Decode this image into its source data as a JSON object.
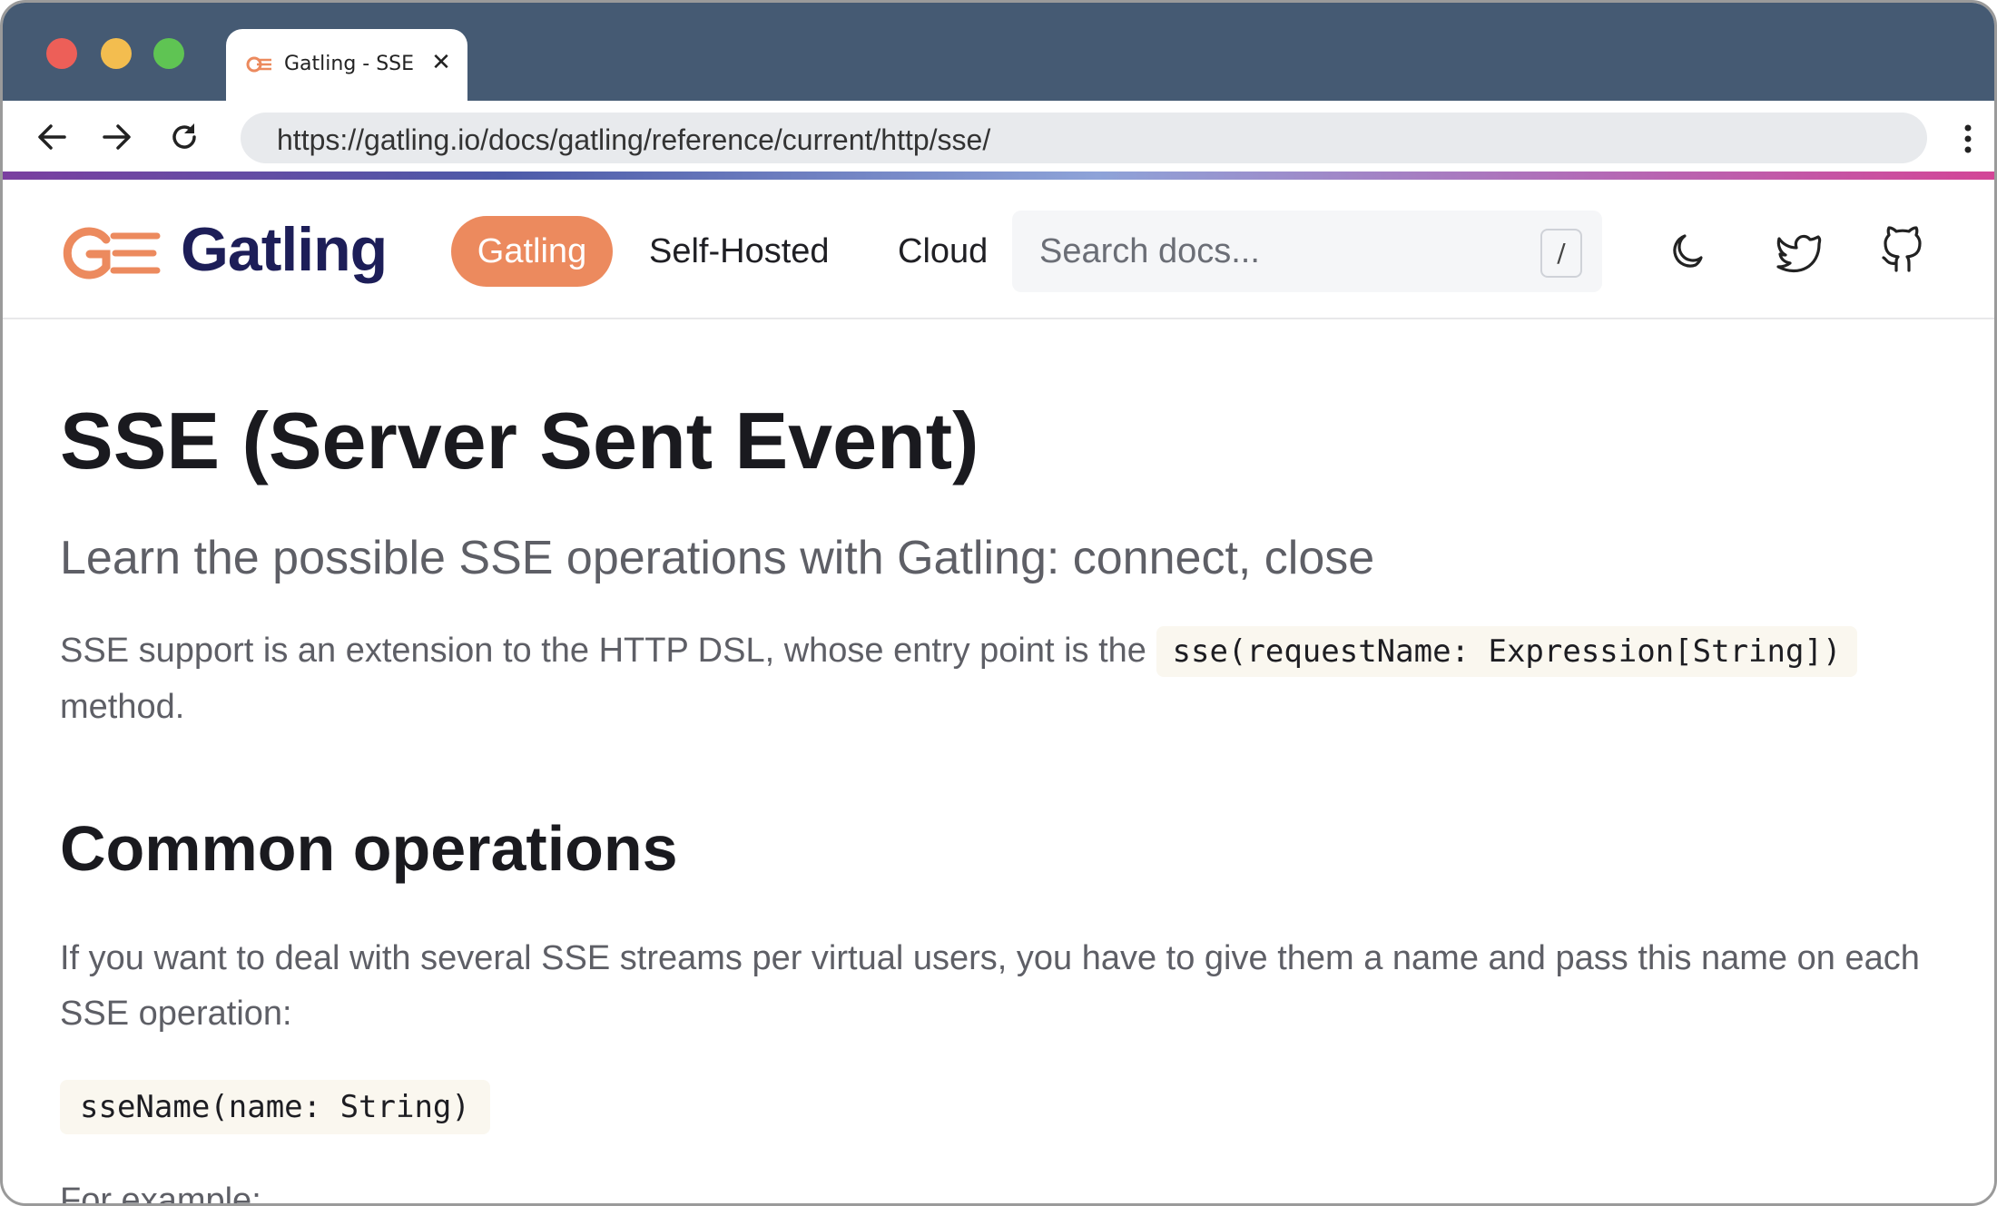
{
  "browser": {
    "tab_title": "Gatling - SSE",
    "tab_close": "✕",
    "url": "https://gatling.io/docs/gatling/reference/current/http/sse/"
  },
  "header": {
    "logo_text": "Gatling",
    "nav": {
      "active_label": "Gatling",
      "self_hosted_label": "Self-Hosted",
      "cloud_label": "Cloud"
    },
    "search": {
      "placeholder": "Search docs...",
      "shortcut": "/"
    },
    "icons": [
      "moon-icon",
      "twitter-icon",
      "github-icon"
    ]
  },
  "page": {
    "title": "SSE (Server Sent Event)",
    "lead": "Learn the possible SSE operations with Gatling: connect, close",
    "intro_text": "SSE support is an extension to the HTTP DSL, whose entry point is the",
    "intro_code": "sse(requestName: Expression[String])",
    "intro_suffix": "method.",
    "section_title": "Common operations",
    "section_text": "If you want to deal with several SSE streams per virtual users, you have to give them a name and pass this name on each SSE operation:",
    "code_block": "sseName(name: String)",
    "example_text": "For example:"
  },
  "colors": {
    "accent": "#ec8a5e",
    "brand_dark": "#1d1e58",
    "titlebar": "#455a73"
  }
}
